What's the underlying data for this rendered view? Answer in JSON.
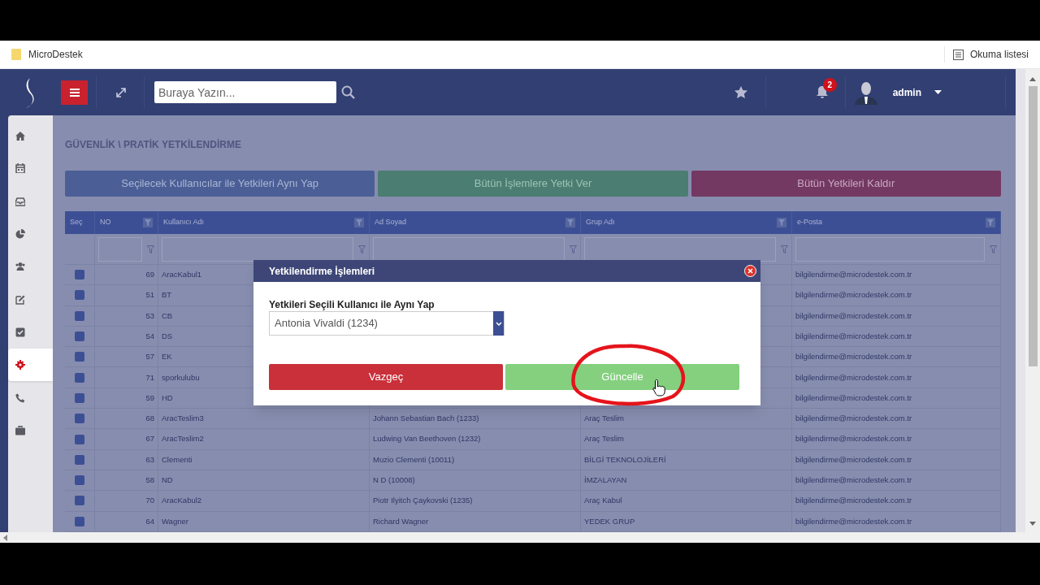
{
  "browser": {
    "title": "MicroDestek",
    "reading_list": "Okuma listesi"
  },
  "header": {
    "search": {
      "placeholder": "Buraya Yazın..."
    },
    "notifications": "2",
    "user": "admin"
  },
  "sidebar": {
    "items": [
      {
        "kind": "home",
        "selected": false
      },
      {
        "kind": "calendar",
        "selected": false
      },
      {
        "kind": "inbox",
        "selected": false
      },
      {
        "kind": "pie",
        "selected": false
      },
      {
        "kind": "users",
        "selected": false
      },
      {
        "kind": "edit",
        "selected": false
      },
      {
        "kind": "check",
        "selected": false
      },
      {
        "kind": "gear",
        "selected": true
      },
      {
        "kind": "phone",
        "selected": false
      },
      {
        "kind": "briefcase",
        "selected": false
      }
    ]
  },
  "breadcrumb": "GÜVENLİK \\ PRATİK YETKİLENDİRME",
  "actions": [
    {
      "label": "Seçilecek Kullanıcılar ile Yetkileri Aynı Yap",
      "kind": "primary"
    },
    {
      "label": "Bütün İşlemlere Yetki Ver",
      "kind": "success"
    },
    {
      "label": "Bütün Yetkileri Kaldır",
      "kind": "danger"
    }
  ],
  "table": {
    "columns": [
      "Seç",
      "NO",
      "Kullanıcı Adı",
      "Ad Soyad",
      "Grup Adı",
      "e-Posta"
    ],
    "rows": [
      {
        "checked": false,
        "no": "69",
        "username": "AracKabul1",
        "email": "bilgilendirme@microdestek.com.tr"
      },
      {
        "checked": false,
        "no": "51",
        "username": "BT",
        "email": "bilgilendirme@microdestek.com.tr"
      },
      {
        "checked": false,
        "no": "53",
        "username": "CB",
        "email": "bilgilendirme@microdestek.com.tr"
      },
      {
        "checked": false,
        "no": "54",
        "username": "DS",
        "email": "bilgilendirme@microdestek.com.tr"
      },
      {
        "checked": false,
        "no": "57",
        "username": "EK",
        "email": "bilgilendirme@microdestek.com.tr"
      },
      {
        "checked": false,
        "no": "71",
        "username": "sporkulubu",
        "email": "bilgilendirme@microdestek.com.tr"
      },
      {
        "checked": false,
        "no": "59",
        "username": "HD",
        "email": "bilgilendirme@microdestek.com.tr"
      },
      {
        "checked": false,
        "no": "68",
        "username": "AracTeslim3",
        "full_name": "Johann Sebastian Bach (1233)",
        "group": "Araç Teslim",
        "email": "bilgilendirme@microdestek.com.tr"
      },
      {
        "checked": false,
        "no": "67",
        "username": "AracTeslim2",
        "full_name": "Ludwing Van Beethoven (1232)",
        "group": "Araç Teslim",
        "email": "bilgilendirme@microdestek.com.tr"
      },
      {
        "checked": false,
        "no": "63",
        "username": "Clementi",
        "full_name": "Muzio Clementi (10011)",
        "group": "BİLGİ TEKNOLOJİLERİ",
        "email": "bilgilendirme@microdestek.com.tr"
      },
      {
        "checked": false,
        "no": "58",
        "username": "ND",
        "full_name": "N D (10008)",
        "group": "İMZALAYAN",
        "email": "bilgilendirme@microdestek.com.tr"
      },
      {
        "checked": false,
        "no": "70",
        "username": "AracKabul2",
        "full_name": "Piotr Ilyitch Çaykovski (1235)",
        "group": "Araç Kabul",
        "email": "bilgilendirme@microdestek.com.tr"
      },
      {
        "checked": false,
        "no": "64",
        "username": "Wagner",
        "full_name": "Richard Wagner",
        "group": "YEDEK GRUP",
        "email": "bilgilendirme@microdestek.com.tr"
      }
    ]
  },
  "dialog": {
    "title": "Yetkilendirme İşlemleri",
    "field_label": "Yetkileri Seçili Kullanıcı ile Aynı Yap",
    "select_value": "Antonia Vivaldi (1234)",
    "buttons": [
      {
        "label": "Vazgeç",
        "kind": "cancel"
      },
      {
        "label": "Güncelle",
        "kind": "confirm"
      }
    ]
  }
}
